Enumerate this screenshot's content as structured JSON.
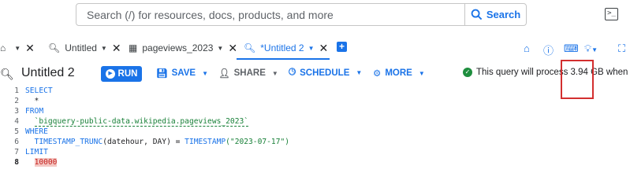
{
  "search": {
    "placeholder": "Search (/) for resources, docs, products, and more",
    "button_label": "Search"
  },
  "tabs": [
    {
      "label": "Untitled",
      "icon": "query-icon"
    },
    {
      "label": "pageviews_2023",
      "icon": "table-icon"
    },
    {
      "label": "*Untitled 2",
      "icon": "query-icon",
      "active": true
    }
  ],
  "toolbar": {
    "title": "Untitled 2",
    "run_label": "RUN",
    "save_label": "SAVE",
    "share_label": "SHARE",
    "schedule_label": "SCHEDULE",
    "more_label": "MORE",
    "status_prefix": "This query will process ",
    "status_amount": "3.94 GB",
    "status_suffix": " when run."
  },
  "editor": {
    "line_numbers": [
      "1",
      "2",
      "3",
      "4",
      "5",
      "6",
      "7",
      "8"
    ],
    "lines": {
      "l1": "SELECT",
      "l2": "  *",
      "l3": "FROM",
      "l4": "`bigquery-public-data.wikipedia.pageviews_2023`",
      "l6_fn": "TIMESTAMP_TRUNC",
      "l6_args": "(datehour, DAY) = ",
      "l6_fn2": "TIMESTAMP",
      "l6_str": "(\"2023-07-17\")",
      "l5": "WHERE",
      "l7": "LIMIT",
      "l8": "10000"
    }
  },
  "colors": {
    "accent": "#1a73e8",
    "success": "#1e8e3e",
    "highlight_box": "#d32f2f"
  }
}
